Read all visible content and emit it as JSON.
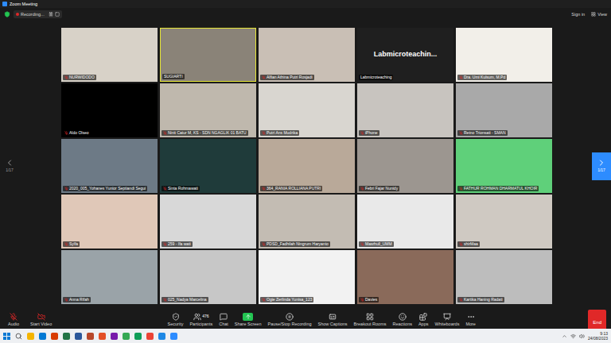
{
  "window": {
    "title": "Zoom Meeting"
  },
  "recording": {
    "label": "Recording..."
  },
  "top_actions": [
    "Sign in",
    "View"
  ],
  "pager": {
    "left": "1/17",
    "right": "1/17"
  },
  "participants": [
    {
      "name": "NURWIDODO",
      "muted": true,
      "speaking": false,
      "kind": "video",
      "color": "#d8d2c8"
    },
    {
      "name": "SUGIARTI",
      "muted": false,
      "speaking": true,
      "kind": "video",
      "color": "#8a8378"
    },
    {
      "name": "Alfian Athina Putri Rosjadi",
      "muted": true,
      "speaking": false,
      "kind": "video",
      "color": "#c9bfb5"
    },
    {
      "name": "Labmicroteaching",
      "display": "Labmicroteachin...",
      "muted": false,
      "speaking": false,
      "kind": "name-only",
      "color": "#1f1f1f"
    },
    {
      "name": "Dra. Umi Kulsum, M.Pd",
      "muted": true,
      "speaking": false,
      "kind": "video",
      "color": "#f2efe9"
    },
    {
      "name": "Aldo Olseo",
      "muted": true,
      "speaking": false,
      "kind": "video",
      "color": "#000000"
    },
    {
      "name": "Ninit Catur M, KS - SDN NGAGLIK 01 BATU",
      "muted": true,
      "speaking": false,
      "kind": "video",
      "color": "#bfb8ad"
    },
    {
      "name": "Putri Ans Mudrika",
      "muted": true,
      "speaking": false,
      "kind": "video",
      "color": "#d9d6d0"
    },
    {
      "name": "iPhone",
      "muted": true,
      "speaking": false,
      "kind": "video",
      "color": "#c8c4bf"
    },
    {
      "name": "Retno Trionsati - SMAN",
      "muted": true,
      "speaking": false,
      "kind": "video",
      "color": "#a9a9a9"
    },
    {
      "name": "2020_005_Yohanes Yunior Septiandi Segui",
      "muted": true,
      "speaking": false,
      "kind": "video",
      "color": "#6d7a86"
    },
    {
      "name": "Sinta Rohmawati",
      "muted": true,
      "speaking": false,
      "kind": "video",
      "color": "#1f3b3a"
    },
    {
      "name": "364_RANIA ROLLIANA PUTRI",
      "muted": true,
      "speaking": false,
      "kind": "video",
      "color": "#b9a999"
    },
    {
      "name": "Febri Fajar Nunidy",
      "muted": true,
      "speaking": false,
      "kind": "video",
      "color": "#9c9690"
    },
    {
      "name": "FATHUR ROHMAN DHARMATUL KHOIR",
      "muted": true,
      "speaking": false,
      "kind": "video",
      "color": "#5fd07a"
    },
    {
      "name": "Sylfa",
      "muted": true,
      "speaking": false,
      "kind": "video",
      "color": "#e0c8b8"
    },
    {
      "name": "259 - Ifa wati",
      "muted": true,
      "speaking": false,
      "kind": "video",
      "color": "#d8d8d8"
    },
    {
      "name": "PDSD_Fadhilah Ningrum Haryanto",
      "muted": true,
      "speaking": false,
      "kind": "video",
      "color": "#c3bcb3"
    },
    {
      "name": "Masrhull_UMM",
      "muted": true,
      "speaking": false,
      "kind": "video",
      "color": "#e9e9e9"
    },
    {
      "name": "shirMaa",
      "muted": true,
      "speaking": false,
      "kind": "video",
      "color": "#cfc9c2"
    },
    {
      "name": "Anna Rifah",
      "muted": true,
      "speaking": false,
      "kind": "video",
      "color": "#9aa3a8"
    },
    {
      "name": "025_Nadya Marcelina",
      "muted": true,
      "speaking": false,
      "kind": "video",
      "color": "#c7c7c7"
    },
    {
      "name": "Ogie Zerlinda Yunisa_123",
      "muted": true,
      "speaking": false,
      "kind": "video",
      "color": "#f2f2f2"
    },
    {
      "name": "Davies",
      "muted": true,
      "speaking": false,
      "kind": "video",
      "color": "#8a6a5a"
    },
    {
      "name": "Kartika Haning Radati",
      "muted": true,
      "speaking": false,
      "kind": "video",
      "color": "#bdbdbd"
    }
  ],
  "toolbar_left": [
    {
      "label": "Audio",
      "kind": "audio",
      "muted": true
    },
    {
      "label": "Start Video",
      "kind": "video",
      "muted": true
    }
  ],
  "toolbar_center": [
    {
      "label": "Security",
      "kind": "security"
    },
    {
      "label": "Participants",
      "kind": "participants",
      "count": "476"
    },
    {
      "label": "Chat",
      "kind": "chat"
    },
    {
      "label": "Share Screen",
      "kind": "share"
    },
    {
      "label": "Pause/Stop Recording",
      "kind": "recording"
    },
    {
      "label": "Show Captions",
      "kind": "captions"
    },
    {
      "label": "Breakout Rooms",
      "kind": "breakout"
    },
    {
      "label": "Reactions",
      "kind": "reactions"
    },
    {
      "label": "Apps",
      "kind": "apps"
    },
    {
      "label": "Whiteboards",
      "kind": "whiteboards"
    },
    {
      "label": "More",
      "kind": "more"
    }
  ],
  "end_button": "End",
  "taskbar": {
    "time": "9:13",
    "date": "24/08/2023"
  }
}
